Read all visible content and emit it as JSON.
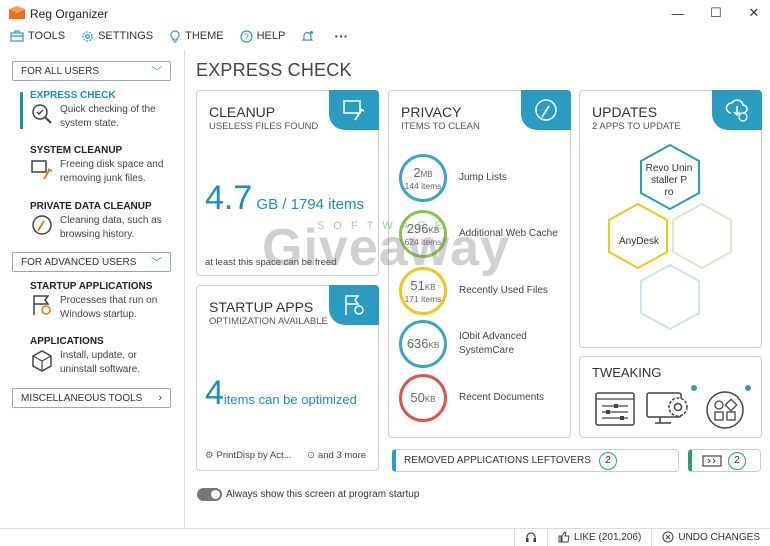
{
  "window": {
    "title": "Reg Organizer",
    "minimize": "—",
    "maximize": "☐",
    "close": "✕"
  },
  "menu": {
    "tools": "TOOLS",
    "settings": "SETTINGS",
    "theme": "THEME",
    "help": "HELP",
    "more": "···"
  },
  "sidebar": {
    "for_all_users": "FOR ALL USERS",
    "express_title": "EXPRESS CHECK",
    "express_desc": [
      "Quick checking of the",
      "system state."
    ],
    "system_title": "SYSTEM CLEANUP",
    "system_desc": [
      "Freeing disk space and",
      "removing junk files."
    ],
    "private_title": "PRIVATE DATA CLEANUP",
    "private_desc": [
      "Cleaning data, such as",
      "browsing history."
    ],
    "for_advanced": "FOR ADVANCED USERS",
    "startup_title": "STARTUP APPLICATIONS",
    "startup_desc": [
      "Processes that run on",
      "Windows startup."
    ],
    "apps_title": "APPLICATIONS",
    "apps_desc": [
      "Install, update, or",
      "uninstall software."
    ],
    "misc": "MISCELLANEOUS TOOLS"
  },
  "page_title": "EXPRESS CHECK",
  "cleanup": {
    "title": "CLEANUP",
    "subtitle": "USELESS FILES FOUND",
    "value": "4.7",
    "unit": " GB / 1794 items",
    "note": "at least this space can be freed"
  },
  "startup": {
    "title": "STARTUP APPS",
    "subtitle": "OPTIMIZATION AVAILABLE",
    "value": "4",
    "unit": "items can be optimized",
    "item1": "PrintDisp by Act...",
    "item2": "and 3 more"
  },
  "privacy": {
    "title": "PRIVACY",
    "subtitle": "ITEMS TO CLEAN",
    "rows": [
      {
        "value": "2",
        "unit": "MB",
        "sub": "144 items",
        "label": "Jump Lists",
        "color": "#3aa7c5"
      },
      {
        "value": "296",
        "unit": "KB",
        "sub": "624 items",
        "label": "Additional Web Cache",
        "color": "#8bc34a"
      },
      {
        "value": "51",
        "unit": "KB",
        "sub": "171 items",
        "label": "Recently Used Files",
        "color": "#f5c518"
      },
      {
        "value": "636",
        "unit": "KB",
        "sub": "",
        "label": "IObit Advanced",
        "label2": "SystemCare",
        "color": "#3aa7c5"
      },
      {
        "value": "50",
        "unit": "KB",
        "sub": "",
        "label": "Recent Documents",
        "color": "#e0524a"
      }
    ]
  },
  "updates": {
    "title": "UPDATES",
    "subtitle": "2 APPS TO UPDATE",
    "app1": [
      "Revo Unin",
      "staller P",
      "ro"
    ],
    "app2": "AnyDesk"
  },
  "tweaking": {
    "title": "TWEAKING"
  },
  "leftovers": {
    "label": "REMOVED APPLICATIONS LEFTOVERS",
    "count": "2",
    "count2": "2"
  },
  "toggle_label": "Always show this screen at program startup",
  "status": {
    "like": "LIKE (201,206)",
    "undo": "UNDO CHANGES"
  },
  "watermark": {
    "main": "Giveaway",
    "sub": "SOFTWARE"
  }
}
